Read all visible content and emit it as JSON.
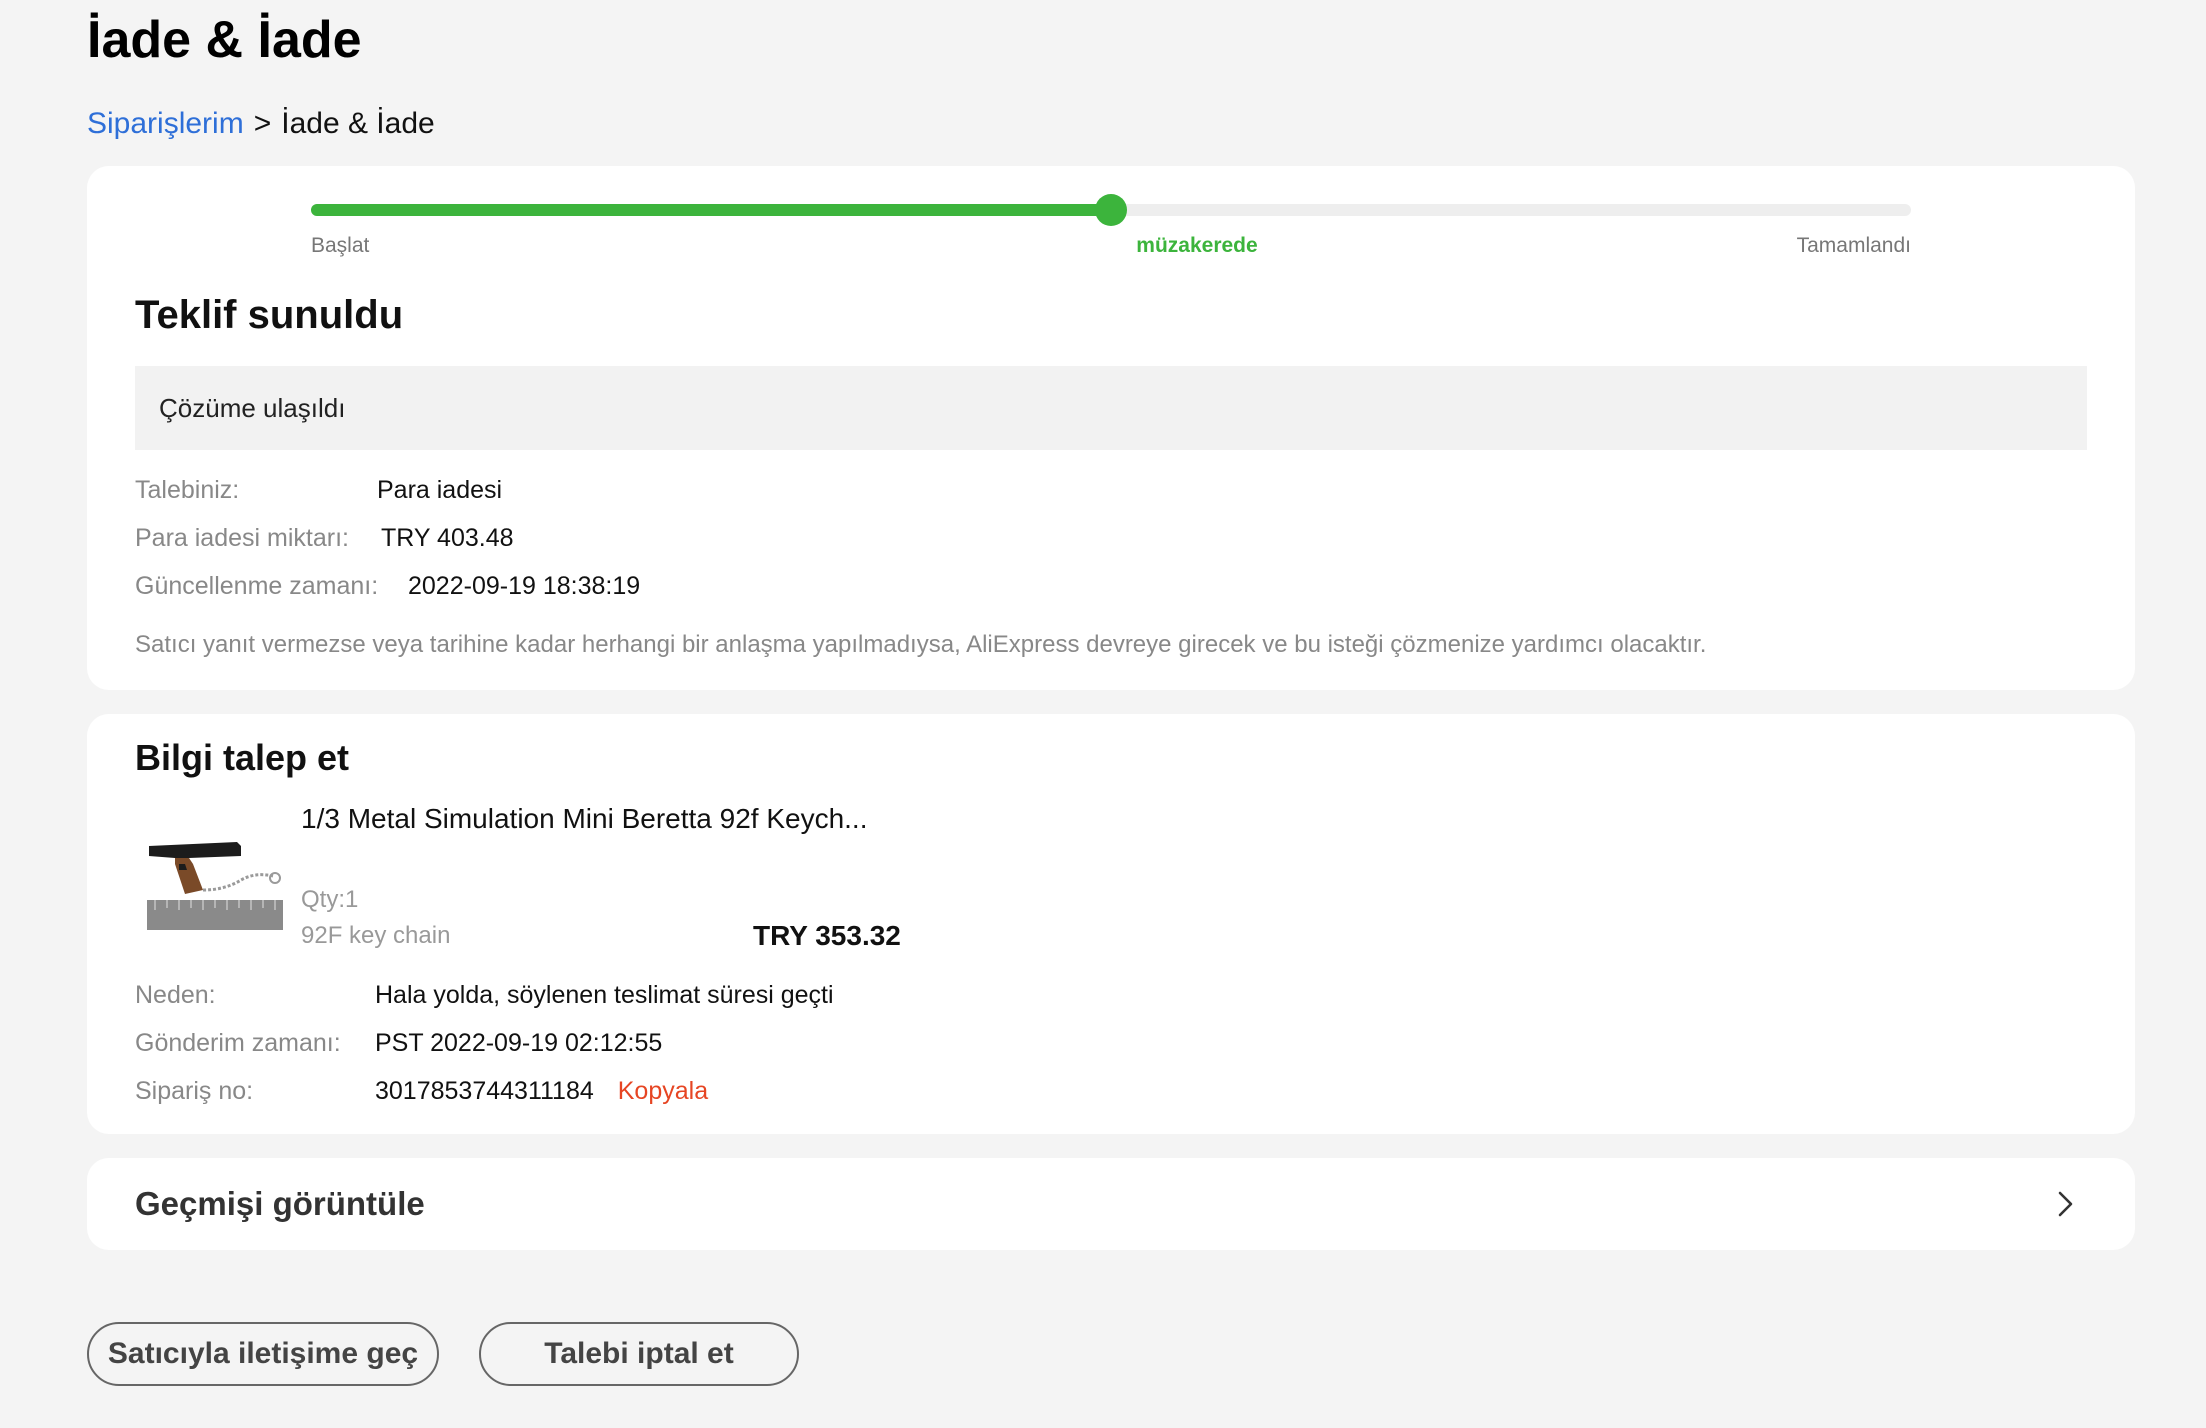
{
  "page": {
    "title": "İade & İade"
  },
  "breadcrumb": {
    "link": "Siparişlerim",
    "separator": ">",
    "current": "İade & İade"
  },
  "progress": {
    "steps": [
      "Başlat",
      "müzakerede",
      "Tamamlandı"
    ],
    "active_step": "müzakerede",
    "fraction": 0.5,
    "accent_color": "#3cb43c"
  },
  "status": {
    "title": "Teklif sunuldu",
    "resolution": "Çözüme ulaşıldı",
    "fields": [
      {
        "label": "Talebiniz:",
        "value": "Para iadesi"
      },
      {
        "label": "Para iadesi miktarı:",
        "value": "TRY 403.48"
      },
      {
        "label": "Güncellenme zamanı:",
        "value": "2022-09-19 18:38:19"
      }
    ],
    "note": "Satıcı yanıt vermezse veya tarihine kadar herhangi bir anlaşma yapılmadıysa, AliExpress devreye girecek ve bu isteği çözmenize yardımcı olacaktır."
  },
  "info": {
    "title": "Bilgi talep et",
    "product": {
      "name": "1/3 Metal Simulation Mini Beretta 92f Keych...",
      "qty": "Qty:1",
      "variant": "92F key chain",
      "price": "TRY 353.32",
      "image_icon": "pistol-keychain-thumbnail"
    },
    "fields": [
      {
        "label": "Neden:",
        "value": "Hala yolda, söylenen teslimat süresi geçti"
      },
      {
        "label": "Gönderim zamanı:",
        "value": "PST 2022-09-19 02:12:55"
      },
      {
        "label": "Sipariş no:",
        "value": "3017853744311184"
      }
    ],
    "copy_label": "Kopyala"
  },
  "history": {
    "label": "Geçmişi görüntüle",
    "icon": "chevron-right-icon"
  },
  "actions": {
    "contact_seller": "Satıcıyla iletişime geç",
    "cancel_request": "Talebi iptal et"
  },
  "colors": {
    "link": "#2e6fd8",
    "copy": "#e64523",
    "background": "#f4f4f4"
  }
}
